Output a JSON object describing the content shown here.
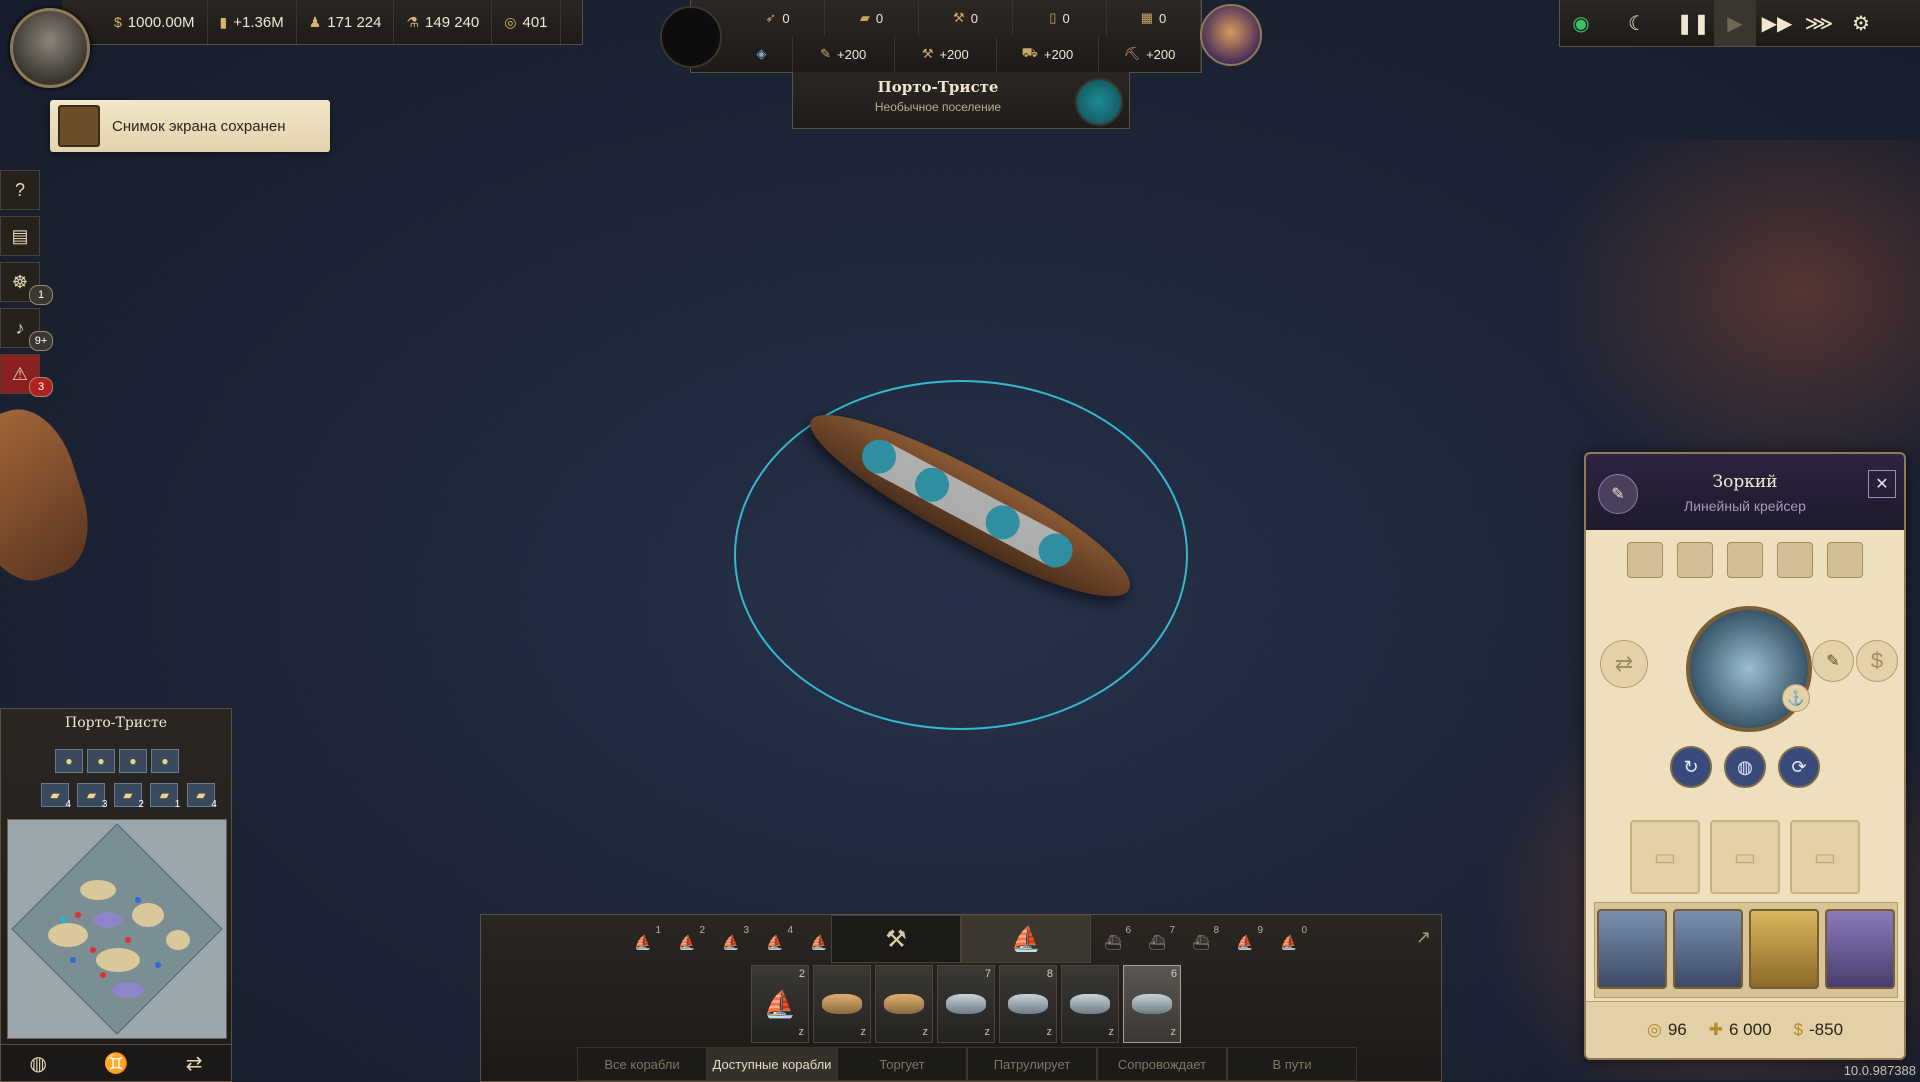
{
  "top_left": {
    "money": "1000.00M",
    "income": "+1.36M",
    "population": "171 224",
    "resource": "149 240",
    "influence": "401"
  },
  "toast": {
    "text": "Снимок экрана сохранен"
  },
  "left_menu": {
    "badges": {
      "ship_wheel": "1",
      "notifications": "9+",
      "alerts": "3"
    }
  },
  "top_center": {
    "row1": [
      "0",
      "0",
      "0",
      "0",
      "0"
    ],
    "row2": [
      "+200",
      "+200",
      "+200",
      "+200"
    ]
  },
  "settlement": {
    "name": "Порто-Тристе",
    "subtitle": "Необычное поселение"
  },
  "minimap_panel": {
    "title": "Порто-Тристе",
    "goods_row1": [
      "",
      "",
      "",
      ""
    ],
    "goods_row2": [
      {
        "count": "4"
      },
      {
        "count": "3"
      },
      {
        "count": "2"
      },
      {
        "count": "1"
      },
      {
        "count": "4"
      }
    ]
  },
  "fleet": {
    "groups_left": [
      "1",
      "2",
      "3",
      "4",
      "5"
    ],
    "groups_right": [
      "6",
      "7",
      "8",
      "9",
      "0"
    ],
    "ship_slots": [
      {
        "n": "2",
        "selected": false
      },
      {
        "n": "",
        "selected": false
      },
      {
        "n": "",
        "selected": false
      },
      {
        "n": "7",
        "selected": false
      },
      {
        "n": "8",
        "selected": false
      },
      {
        "n": "",
        "selected": false
      },
      {
        "n": "6",
        "selected": true
      }
    ],
    "filters": [
      "Все корабли",
      "Доступные корабли",
      "Торгует",
      "Патрулирует",
      "Сопровождает",
      "В пути"
    ],
    "active_filter": "Доступные корабли"
  },
  "ship_panel": {
    "name": "Зоркий",
    "type": "Линейный крейсер",
    "footer": {
      "value1": "96",
      "value2": "6 000",
      "value3": "-850"
    }
  },
  "version": "10.0.987388"
}
